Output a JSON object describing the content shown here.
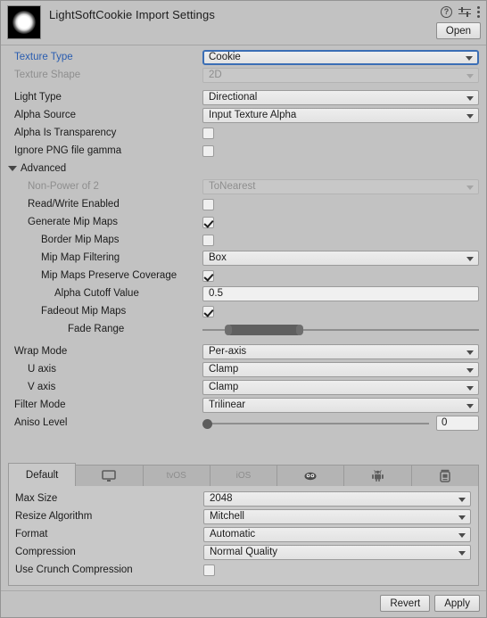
{
  "header": {
    "title": "LightSoftCookie Import Settings",
    "preview_icon": "texture-preview-soft-circle",
    "help_icon": "help-icon",
    "preset_icon": "preset-settings-icon",
    "menu_icon": "kebab-menu-icon",
    "open_label": "Open"
  },
  "main": {
    "rows": [
      {
        "label": "Texture Type",
        "indent": 0,
        "type": "dropdown",
        "value": "Cookie",
        "state": "focused"
      },
      {
        "label": "Texture Shape",
        "indent": 0,
        "type": "dropdown",
        "value": "2D",
        "state": "disabled"
      },
      {
        "label": "Light Type",
        "indent": 0,
        "type": "dropdown",
        "value": "Directional",
        "state": "normal",
        "gap": true
      },
      {
        "label": "Alpha Source",
        "indent": 0,
        "type": "dropdown",
        "value": "Input Texture Alpha",
        "state": "normal"
      },
      {
        "label": "Alpha Is Transparency",
        "indent": 0,
        "type": "checkbox",
        "checked": false
      },
      {
        "label": "Ignore PNG file gamma",
        "indent": 0,
        "type": "checkbox",
        "checked": false
      }
    ],
    "advanced": {
      "label": "Advanced",
      "expanded": true,
      "rows": [
        {
          "label": "Non-Power of 2",
          "indent": 1,
          "type": "dropdown",
          "value": "ToNearest",
          "state": "disabled"
        },
        {
          "label": "Read/Write Enabled",
          "indent": 1,
          "type": "checkbox",
          "checked": false
        },
        {
          "label": "Generate Mip Maps",
          "indent": 1,
          "type": "checkbox",
          "checked": true
        },
        {
          "label": "Border Mip Maps",
          "indent": 2,
          "type": "checkbox",
          "checked": false
        },
        {
          "label": "Mip Map Filtering",
          "indent": 2,
          "type": "dropdown",
          "value": "Box",
          "state": "normal"
        },
        {
          "label": "Mip Maps Preserve Coverage",
          "indent": 2,
          "type": "checkbox",
          "checked": true
        },
        {
          "label": "Alpha Cutoff Value",
          "indent": 3,
          "type": "textfield",
          "value": "0.5"
        },
        {
          "label": "Fadeout Mip Maps",
          "indent": 2,
          "type": "checkbox",
          "checked": true
        },
        {
          "label": "Fade Range",
          "indent": 3,
          "type": "rangeslider",
          "min_pct": 8,
          "max_pct": 34
        }
      ]
    },
    "rows2": [
      {
        "label": "Wrap Mode",
        "indent": 0,
        "type": "dropdown",
        "value": "Per-axis",
        "state": "normal",
        "gap": true
      },
      {
        "label": "U axis",
        "indent": 1,
        "type": "dropdown",
        "value": "Clamp",
        "state": "normal"
      },
      {
        "label": "V axis",
        "indent": 1,
        "type": "dropdown",
        "value": "Clamp",
        "state": "normal"
      },
      {
        "label": "Filter Mode",
        "indent": 0,
        "type": "dropdown",
        "value": "Trilinear",
        "state": "normal"
      },
      {
        "label": "Aniso Level",
        "indent": 0,
        "type": "anisoslider",
        "value": "0",
        "knob_pct": 0
      }
    ]
  },
  "platform": {
    "tabs": [
      {
        "label": "Default",
        "icon": "",
        "active": true,
        "name": "tab-default"
      },
      {
        "label": "",
        "icon": "standalone-icon",
        "active": false,
        "name": "tab-standalone"
      },
      {
        "label": "tvOS",
        "icon": "",
        "active": false,
        "name": "tab-tvos"
      },
      {
        "label": "iOS",
        "icon": "",
        "active": false,
        "name": "tab-ios"
      },
      {
        "label": "",
        "icon": "webgl-icon",
        "active": false,
        "name": "tab-webgl"
      },
      {
        "label": "",
        "icon": "android-icon",
        "active": false,
        "name": "tab-android"
      },
      {
        "label": "",
        "icon": "server-icon",
        "active": false,
        "name": "tab-server"
      }
    ],
    "rows": [
      {
        "label": "Max Size",
        "type": "dropdown",
        "value": "2048"
      },
      {
        "label": "Resize Algorithm",
        "type": "dropdown",
        "value": "Mitchell"
      },
      {
        "label": "Format",
        "type": "dropdown",
        "value": "Automatic"
      },
      {
        "label": "Compression",
        "type": "dropdown",
        "value": "Normal Quality"
      },
      {
        "label": "Use Crunch Compression",
        "type": "checkbox",
        "checked": false
      }
    ]
  },
  "footer": {
    "revert_label": "Revert",
    "apply_label": "Apply"
  },
  "colors": {
    "background": "#c2c2c2",
    "panel": "#c8c8c8",
    "accent_blue": "#2a5db0",
    "focus_border": "#3b6eb5",
    "text": "#1b1b1b",
    "disabled_text": "#8e8e8e"
  }
}
